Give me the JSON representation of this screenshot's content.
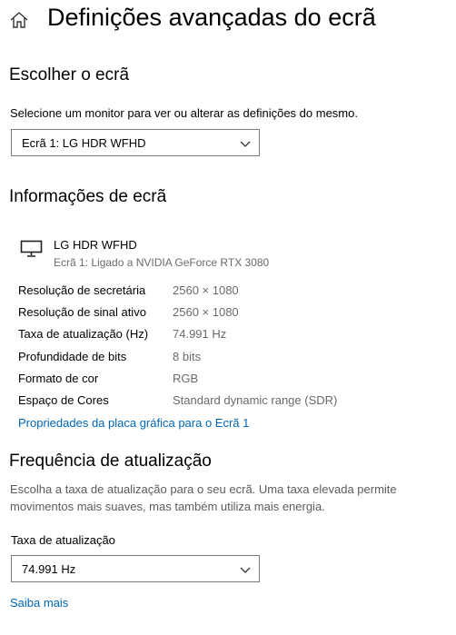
{
  "header": {
    "title": "Definições avançadas do ecrã"
  },
  "choose_display": {
    "heading": "Escolher o ecrã",
    "instruction": "Selecione um monitor para ver ou alterar as definições do mesmo.",
    "selected_display": "Ecrã 1: LG HDR WFHD"
  },
  "display_info": {
    "heading": "Informações de ecrã",
    "monitor_name": "LG HDR WFHD",
    "monitor_subtitle": "Ecrã 1: Ligado a NVIDIA GeForce RTX 3080",
    "rows": [
      {
        "label": "Resolução de secretária",
        "value": "2560 × 1080"
      },
      {
        "label": "Resolução de sinal ativo",
        "value": "2560 × 1080"
      },
      {
        "label": "Taxa de atualização (Hz)",
        "value": "74.991 Hz"
      },
      {
        "label": "Profundidade de bits",
        "value": "8 bits"
      },
      {
        "label": "Formato de cor",
        "value": "RGB"
      },
      {
        "label": "Espaço de Cores",
        "value": "Standard dynamic range (SDR)"
      }
    ],
    "adapter_link": "Propriedades da placa gráfica para o Ecrã 1"
  },
  "refresh": {
    "heading": "Frequência de atualização",
    "description": "Escolha a taxa de atualização para o seu ecrã. Uma taxa elevada permite movimentos mais suaves, mas também utiliza mais energia.",
    "rate_label": "Taxa de atualização",
    "selected_rate": "74.991 Hz",
    "learn_more": "Saiba mais"
  },
  "colors": {
    "link": "#0067b8",
    "border": "#7a7a7a",
    "secondary_text": "#6a6a6a"
  },
  "icons": {
    "home": "home-icon",
    "monitor": "monitor-icon",
    "dropdown": "chevron-down-icon"
  }
}
